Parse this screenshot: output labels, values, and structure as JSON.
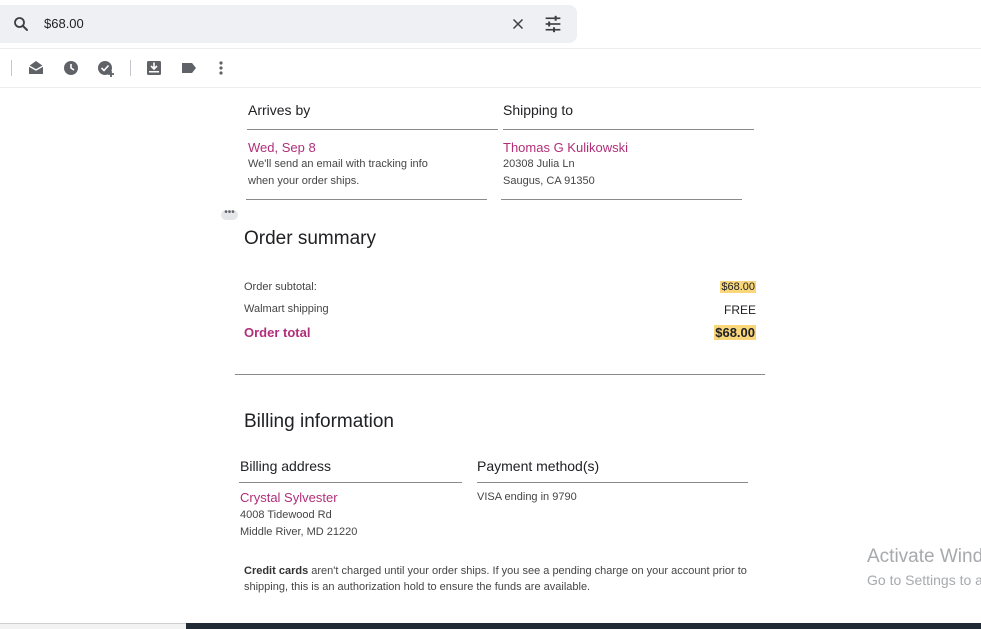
{
  "search": {
    "query": "$68.00"
  },
  "toolbar": {
    "icons": [
      "mark-unread-icon",
      "snooze-icon",
      "add-task-icon",
      "move-to-inbox-icon",
      "label-icon",
      "more-vert-icon"
    ]
  },
  "shipping": {
    "arrives_title": "Arrives by",
    "arrives_date": "Wed, Sep 8",
    "arrives_note_1": "We'll send an email with tracking info",
    "arrives_note_2": "when your order ships.",
    "ship_title": "Shipping to",
    "ship_name": "Thomas G Kulikowski",
    "ship_addr_1": "20308 Julia Ln",
    "ship_addr_2": "Saugus, CA 91350"
  },
  "summary": {
    "heading": "Order summary",
    "subtotal_label": "Order subtotal:",
    "subtotal_value": "$68.00",
    "shipping_label": "Walmart shipping",
    "shipping_value": "FREE",
    "total_label": "Order total",
    "total_value": "$68.00"
  },
  "billing": {
    "heading": "Billing information",
    "address_title": "Billing address",
    "name": "Crystal Sylvester",
    "addr_1": "4008 Tidewood Rd",
    "addr_2": "Middle River, MD 21220",
    "payment_title": "Payment method(s)",
    "payment_value": "VISA ending in 9790"
  },
  "note": {
    "bold": "Credit cards",
    "text": " aren't charged until your order ships. If you see a pending charge on your account prior to shipping, this is an authorization hold to ensure the funds are available."
  },
  "watermark": {
    "title": "Activate Windows",
    "subtitle": "Go to Settings to activate Windows."
  },
  "colors": {
    "accent": "#b12e79",
    "highlight": "#f9d67a"
  }
}
